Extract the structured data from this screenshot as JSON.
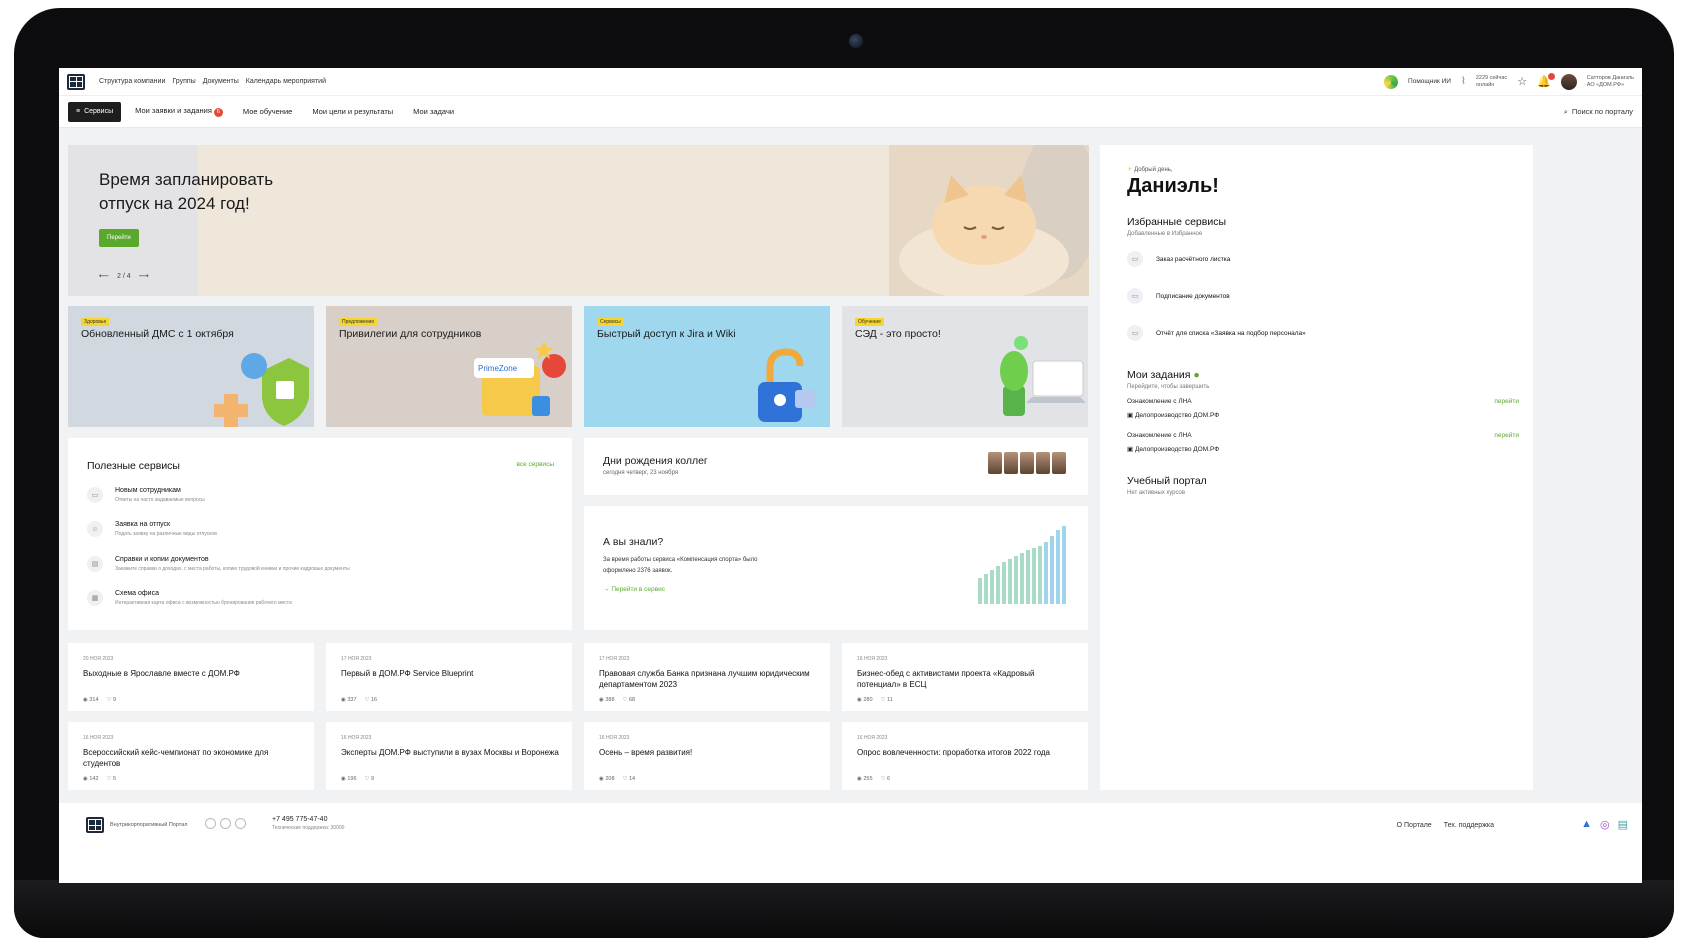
{
  "topbar": {
    "links": [
      "Структура компании",
      "Группы",
      "Документы",
      "Календарь мероприятий"
    ],
    "ai_label": "Помощник ИИ",
    "online_count": "2229 сейчас",
    "online_label": "онлайн",
    "notif_count": "1",
    "user_name": "Сатторов Даниэль",
    "user_org": "АО «ДОМ.РФ»"
  },
  "nav": {
    "services": "Сервисы",
    "links": [
      "Мои заявки и задания",
      "Мое обучение",
      "Мои цели и результаты",
      "Мои задачи"
    ],
    "tasks_badge": "6",
    "search": "Поиск по порталу"
  },
  "hero": {
    "title": "Время запланировать отпуск на 2024 год!",
    "button": "Перейти",
    "pager": "2 / 4"
  },
  "promos": [
    {
      "tag": "Здоровье",
      "title": "Обновленный ДМС с 1 октября"
    },
    {
      "tag": "Предложение",
      "title": "Привилегии для сотрудников"
    },
    {
      "tag": "Сервисы",
      "title": "Быстрый доступ к Jira и Wiki"
    },
    {
      "tag": "Обучение",
      "title": "СЭД - это просто!"
    }
  ],
  "prime_zone": "PrimeZone",
  "useful": {
    "title": "Полезные сервисы",
    "all": "все сервисы",
    "items": [
      {
        "title": "Новым сотрудникам",
        "desc": "Ответы на часто задаваемые вопросы"
      },
      {
        "title": "Заявка на отпуск",
        "desc": "Подать заявку на различные виды отпусков"
      },
      {
        "title": "Справки и копии документов",
        "desc": "Закажите справки о доходах, с места работы, копию трудовой книжки и прочие кадровые документы"
      },
      {
        "title": "Схема офиса",
        "desc": "Интерактивная карта офиса с возможностью бронирования рабочего места"
      }
    ]
  },
  "birthday": {
    "title": "Дни рождения коллег",
    "sub": "сегодня четверг, 23 ноября"
  },
  "know": {
    "title": "А вы знали?",
    "text": "За время работы сервиса «Компенсация спорта» было оформлено 2376 заявок.",
    "link": "Перейти в сервис"
  },
  "news": [
    {
      "date": "20 НОЯ 2023",
      "title": "Выходные в Ярославле вместе с ДОМ.РФ",
      "views": "314",
      "likes": "9"
    },
    {
      "date": "17 НОЯ 2023",
      "title": "Первый в ДОМ.РФ Service Blueprint",
      "views": "337",
      "likes": "16"
    },
    {
      "date": "17 НОЯ 2023",
      "title": "Правовая служба Банка признана лучшим юридическим департаментом 2023",
      "views": "388",
      "likes": "68"
    },
    {
      "date": "16 НОЯ 2023",
      "title": "Бизнес-обед с активистами проекта «Кадровый потенциал» в ЕСЦ",
      "views": "280",
      "likes": "11"
    },
    {
      "date": "16 НОЯ 2023",
      "title": "Всероссийский кейс-чемпионат по экономике для студентов",
      "views": "142",
      "likes": "5"
    },
    {
      "date": "16 НОЯ 2023",
      "title": "Эксперты ДОМ.РФ выступили в вузах Москвы и Воронежа",
      "views": "196",
      "likes": "9"
    },
    {
      "date": "16 НОЯ 2023",
      "title": "Осень – время развития!",
      "views": "208",
      "likes": "14"
    },
    {
      "date": "16 НОЯ 2023",
      "title": "Опрос вовлеченности: проработка итогов 2022 года",
      "views": "255",
      "likes": "6"
    }
  ],
  "side": {
    "greet": "Добрый день,",
    "name": "Даниэль!",
    "fav_title": "Избранные сервисы",
    "fav_sub": "Добавленные в Избранное",
    "favs": [
      "Заказ расчётного листка",
      "Подписание документов",
      "Отчёт для списка «Заявка на подбор персонала»"
    ],
    "tasks_title": "Мои задания",
    "tasks_sub": "Перейдите, чтобы завершить",
    "tasks": [
      {
        "title": "Ознакомление с ЛНА",
        "org": "Делопроизводство ДОМ.РФ",
        "go": "перейти"
      },
      {
        "title": "Ознакомление с ЛНА",
        "org": "Делопроизводство ДОМ.РФ",
        "go": "перейти"
      }
    ],
    "learn_title": "Учебный портал",
    "learn_sub": "Нет активных курсов"
  },
  "footer": {
    "portal": "Внутрикорпоративный Портал",
    "phone": "+7 495 775-47-40",
    "phone_sub": "Технические поддержка: 30000",
    "about": "О Портале",
    "support": "Тех. поддержка"
  },
  "colors": {
    "accent": "#5aa92d",
    "badge": "#e5483b",
    "dark": "#1e1e20"
  }
}
